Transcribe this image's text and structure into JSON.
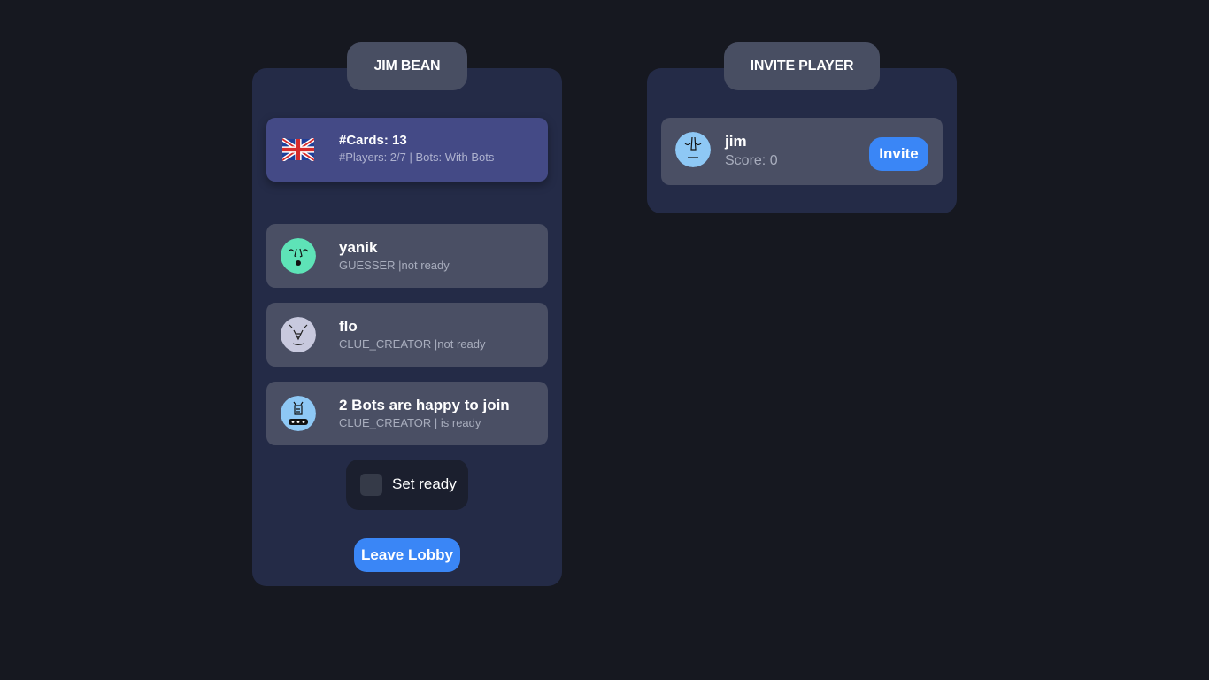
{
  "lobby": {
    "tab_label": "JIM BEAN",
    "game": {
      "flag_icon": "uk-flag-icon",
      "cards_label": "#Cards: 13",
      "info_label": "#Players: 2/7 | Bots: With Bots"
    },
    "players": [
      {
        "name": "yanik",
        "status": "GUESSER |not ready",
        "avatar_color": "#5ee3b7",
        "avatar_icon": "happy-face-icon"
      },
      {
        "name": "flo",
        "status": "CLUE_CREATOR |not ready",
        "avatar_color": "#c8c9de",
        "avatar_icon": "sketch-face-icon"
      },
      {
        "name": "2 Bots are happy to join",
        "status": "CLUE_CREATOR | is ready",
        "avatar_color": "#8ec8f5",
        "avatar_icon": "bot-face-icon"
      }
    ],
    "ready_label": "Set ready",
    "leave_label": "Leave Lobby"
  },
  "invite": {
    "tab_label": "INVITE PLAYER",
    "player": {
      "name": "jim",
      "score": "Score: 0",
      "avatar_color": "#8ec8f5",
      "avatar_icon": "sad-face-icon"
    },
    "invite_label": "Invite"
  },
  "colors": {
    "background": "#161820",
    "panel": "#242b47",
    "card": "#4a4f64",
    "game_card": "#444a86",
    "accent": "#3a86f6"
  }
}
